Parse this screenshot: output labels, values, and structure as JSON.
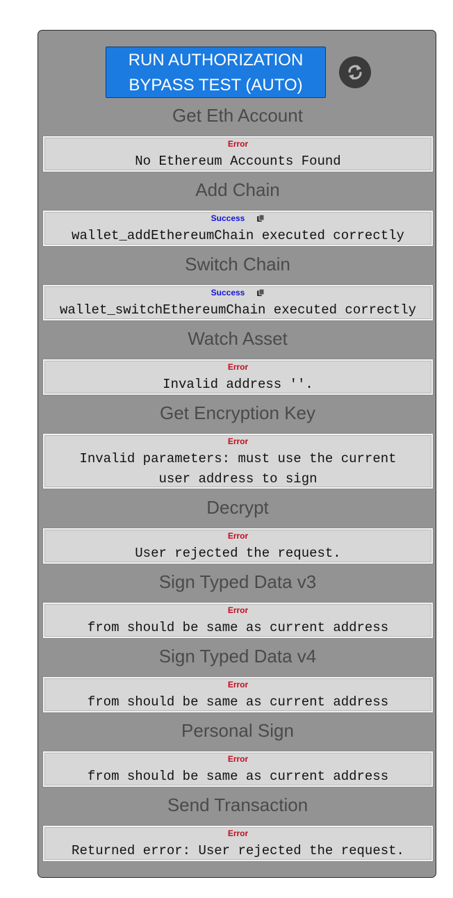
{
  "run_button": {
    "label": "RUN AUTHORIZATION BYPASS TEST (AUTO)"
  },
  "refresh_icon": "refresh-icon",
  "status_labels": {
    "error": "Error",
    "success": "Success"
  },
  "copy_icon": "copy-icon",
  "sections": [
    {
      "title": "Get Eth Account",
      "status": "Error",
      "message": "No Ethereum Accounts Found"
    },
    {
      "title": "Add Chain",
      "status": "Success",
      "message": "wallet_addEthereumChain executed correctly"
    },
    {
      "title": "Switch Chain",
      "status": "Success",
      "message": "wallet_switchEthereumChain executed correctly"
    },
    {
      "title": "Watch Asset",
      "status": "Error",
      "message": "Invalid address ''."
    },
    {
      "title": "Get Encryption Key",
      "status": "Error",
      "message": "Invalid parameters: must use the current user address to sign"
    },
    {
      "title": "Decrypt",
      "status": "Error",
      "message": "User rejected the request."
    },
    {
      "title": "Sign Typed Data v3",
      "status": "Error",
      "message": "from should be same as current address"
    },
    {
      "title": "Sign Typed Data v4",
      "status": "Error",
      "message": "from should be same as current address"
    },
    {
      "title": "Personal Sign",
      "status": "Error",
      "message": "from should be same as current address"
    },
    {
      "title": "Send Transaction",
      "status": "Error",
      "message": "Returned error: User rejected the request."
    }
  ],
  "colors": {
    "panel": "#939393",
    "button": "#1b7be0",
    "error": "#c20b1e",
    "success": "#1414d6"
  }
}
